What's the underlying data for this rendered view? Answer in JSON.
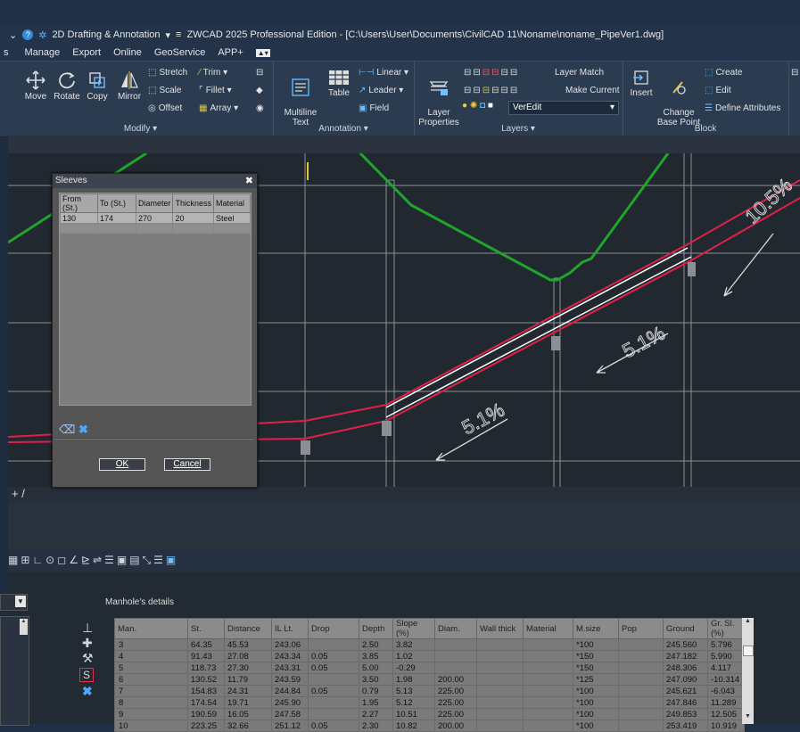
{
  "titlebar": {
    "workspace": "2D Drafting & Annotation",
    "title": "ZWCAD 2025 Professional Edition - [C:\\Users\\User\\Documents\\CivilCAD 11\\Noname\\noname_PipeVer1.dwg]"
  },
  "menubar": {
    "items": [
      "Manage",
      "Export",
      "Online",
      "GeoService",
      "APP+"
    ]
  },
  "ribbon": {
    "modify": {
      "title": "Modify ▾",
      "move": "Move",
      "rotate": "Rotate",
      "copy": "Copy",
      "mirror": "Mirror",
      "stretch": "Stretch",
      "scale": "Scale",
      "offset": "Offset",
      "trim": "Trim ▾",
      "fillet": "Fillet ▾",
      "array": "Array ▾"
    },
    "annotation": {
      "title": "Annotation ▾",
      "multiline_text": "Multiline\nText",
      "table": "Table",
      "linear": "Linear ▾",
      "leader": "Leader ▾",
      "field": "Field"
    },
    "layers": {
      "title": "Layers ▾",
      "layer_properties": "Layer\nProperties",
      "layer_match": "Layer Match",
      "make_current": "Make Current",
      "current_layer": "VerEdit"
    },
    "block": {
      "title": "Block",
      "insert": "Insert",
      "change_base_point": "Change\nBase Point",
      "create": "Create",
      "edit": "Edit",
      "define_attributes": "Define Attributes"
    }
  },
  "drawing": {
    "slope_labels": [
      "10.5%",
      "5.1%",
      "5.1%"
    ],
    "colors": {
      "ground": "#1fa52a",
      "pipe": "#e0204a",
      "pipe_inner": "#ffffff",
      "grid": "#8c8f94",
      "background": "#212830"
    }
  },
  "model_tab": {
    "plus": "+ /"
  },
  "sleeves_dialog": {
    "title": "Sleeves",
    "columns": [
      "From (St.)",
      "To (St.)",
      "Diameter",
      "Thickness",
      "Material"
    ],
    "rows": [
      [
        "130",
        "174",
        "270",
        "20",
        "Steel"
      ]
    ],
    "ok_label": "OK",
    "cancel_label": "Cancel"
  },
  "manholes": {
    "title": "Manhole's details",
    "columns": [
      "Man.",
      "St.",
      "Distance",
      "IL Lt.",
      "Drop",
      "Depth",
      "Slope (%)",
      "Diam.",
      "Wall thick",
      "Material",
      "M.size",
      "Pop",
      "Ground",
      "Gr. Sl.(%)"
    ],
    "rows": [
      [
        "3",
        "64.35",
        "45.53",
        "243.06",
        "",
        "2.50",
        "3.82",
        "",
        "",
        "",
        "*100",
        "",
        "245.560",
        "5.796"
      ],
      [
        "4",
        "91.43",
        "27.08",
        "243.34",
        "0.05",
        "3.85",
        "1.02",
        "",
        "",
        "",
        "*150",
        "",
        "247.182",
        "5.990"
      ],
      [
        "5",
        "118.73",
        "27.30",
        "243.31",
        "0.05",
        "5.00",
        "-0.29",
        "",
        "",
        "",
        "*150",
        "",
        "248.306",
        "4.117"
      ],
      [
        "6",
        "130.52",
        "11.79",
        "243.59",
        "",
        "3.50",
        "1.98",
        "200.00",
        "",
        "",
        "*125",
        "",
        "247.090",
        "-10.314"
      ],
      [
        "7",
        "154.83",
        "24.31",
        "244.84",
        "0.05",
        "0.79",
        "5.13",
        "225.00",
        "",
        "",
        "*100",
        "",
        "245.621",
        "-6.043"
      ],
      [
        "8",
        "174.54",
        "19.71",
        "245.90",
        "",
        "1.95",
        "5.12",
        "225.00",
        "",
        "",
        "*100",
        "",
        "247.846",
        "11.289"
      ],
      [
        "9",
        "190.59",
        "16.05",
        "247.58",
        "",
        "2.27",
        "10.51",
        "225.00",
        "",
        "",
        "*100",
        "",
        "249.853",
        "12.505"
      ],
      [
        "10",
        "223.25",
        "32.66",
        "251.12",
        "0.05",
        "2.30",
        "10.82",
        "200.00",
        "",
        "",
        "*100",
        "",
        "253.419",
        "10.919"
      ]
    ]
  }
}
